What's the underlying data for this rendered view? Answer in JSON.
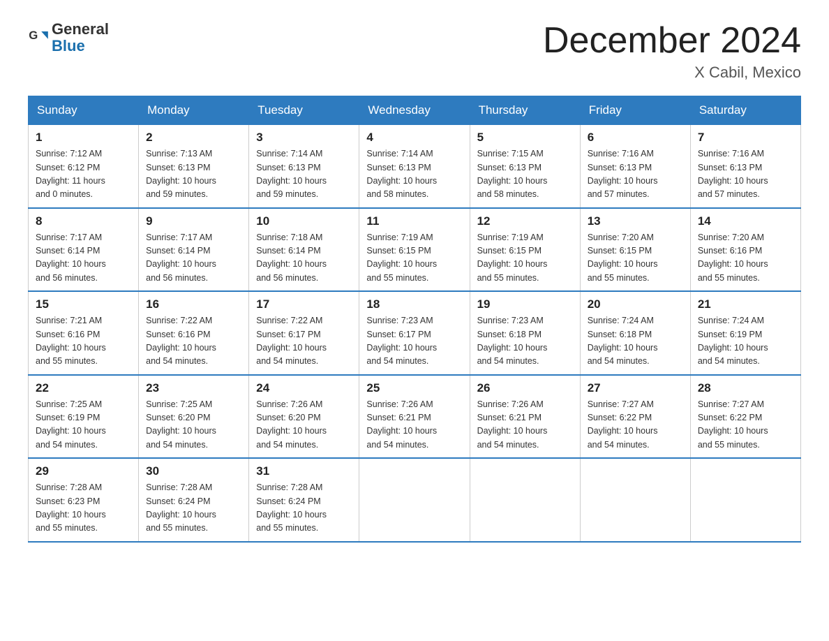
{
  "header": {
    "logo_line1": "General",
    "logo_line2": "Blue",
    "title": "December 2024",
    "subtitle": "X Cabil, Mexico"
  },
  "days_of_week": [
    "Sunday",
    "Monday",
    "Tuesday",
    "Wednesday",
    "Thursday",
    "Friday",
    "Saturday"
  ],
  "weeks": [
    [
      {
        "day": "1",
        "sunrise": "7:12 AM",
        "sunset": "6:12 PM",
        "daylight": "11 hours and 0 minutes."
      },
      {
        "day": "2",
        "sunrise": "7:13 AM",
        "sunset": "6:13 PM",
        "daylight": "10 hours and 59 minutes."
      },
      {
        "day": "3",
        "sunrise": "7:14 AM",
        "sunset": "6:13 PM",
        "daylight": "10 hours and 59 minutes."
      },
      {
        "day": "4",
        "sunrise": "7:14 AM",
        "sunset": "6:13 PM",
        "daylight": "10 hours and 58 minutes."
      },
      {
        "day": "5",
        "sunrise": "7:15 AM",
        "sunset": "6:13 PM",
        "daylight": "10 hours and 58 minutes."
      },
      {
        "day": "6",
        "sunrise": "7:16 AM",
        "sunset": "6:13 PM",
        "daylight": "10 hours and 57 minutes."
      },
      {
        "day": "7",
        "sunrise": "7:16 AM",
        "sunset": "6:13 PM",
        "daylight": "10 hours and 57 minutes."
      }
    ],
    [
      {
        "day": "8",
        "sunrise": "7:17 AM",
        "sunset": "6:14 PM",
        "daylight": "10 hours and 56 minutes."
      },
      {
        "day": "9",
        "sunrise": "7:17 AM",
        "sunset": "6:14 PM",
        "daylight": "10 hours and 56 minutes."
      },
      {
        "day": "10",
        "sunrise": "7:18 AM",
        "sunset": "6:14 PM",
        "daylight": "10 hours and 56 minutes."
      },
      {
        "day": "11",
        "sunrise": "7:19 AM",
        "sunset": "6:15 PM",
        "daylight": "10 hours and 55 minutes."
      },
      {
        "day": "12",
        "sunrise": "7:19 AM",
        "sunset": "6:15 PM",
        "daylight": "10 hours and 55 minutes."
      },
      {
        "day": "13",
        "sunrise": "7:20 AM",
        "sunset": "6:15 PM",
        "daylight": "10 hours and 55 minutes."
      },
      {
        "day": "14",
        "sunrise": "7:20 AM",
        "sunset": "6:16 PM",
        "daylight": "10 hours and 55 minutes."
      }
    ],
    [
      {
        "day": "15",
        "sunrise": "7:21 AM",
        "sunset": "6:16 PM",
        "daylight": "10 hours and 55 minutes."
      },
      {
        "day": "16",
        "sunrise": "7:22 AM",
        "sunset": "6:16 PM",
        "daylight": "10 hours and 54 minutes."
      },
      {
        "day": "17",
        "sunrise": "7:22 AM",
        "sunset": "6:17 PM",
        "daylight": "10 hours and 54 minutes."
      },
      {
        "day": "18",
        "sunrise": "7:23 AM",
        "sunset": "6:17 PM",
        "daylight": "10 hours and 54 minutes."
      },
      {
        "day": "19",
        "sunrise": "7:23 AM",
        "sunset": "6:18 PM",
        "daylight": "10 hours and 54 minutes."
      },
      {
        "day": "20",
        "sunrise": "7:24 AM",
        "sunset": "6:18 PM",
        "daylight": "10 hours and 54 minutes."
      },
      {
        "day": "21",
        "sunrise": "7:24 AM",
        "sunset": "6:19 PM",
        "daylight": "10 hours and 54 minutes."
      }
    ],
    [
      {
        "day": "22",
        "sunrise": "7:25 AM",
        "sunset": "6:19 PM",
        "daylight": "10 hours and 54 minutes."
      },
      {
        "day": "23",
        "sunrise": "7:25 AM",
        "sunset": "6:20 PM",
        "daylight": "10 hours and 54 minutes."
      },
      {
        "day": "24",
        "sunrise": "7:26 AM",
        "sunset": "6:20 PM",
        "daylight": "10 hours and 54 minutes."
      },
      {
        "day": "25",
        "sunrise": "7:26 AM",
        "sunset": "6:21 PM",
        "daylight": "10 hours and 54 minutes."
      },
      {
        "day": "26",
        "sunrise": "7:26 AM",
        "sunset": "6:21 PM",
        "daylight": "10 hours and 54 minutes."
      },
      {
        "day": "27",
        "sunrise": "7:27 AM",
        "sunset": "6:22 PM",
        "daylight": "10 hours and 54 minutes."
      },
      {
        "day": "28",
        "sunrise": "7:27 AM",
        "sunset": "6:22 PM",
        "daylight": "10 hours and 55 minutes."
      }
    ],
    [
      {
        "day": "29",
        "sunrise": "7:28 AM",
        "sunset": "6:23 PM",
        "daylight": "10 hours and 55 minutes."
      },
      {
        "day": "30",
        "sunrise": "7:28 AM",
        "sunset": "6:24 PM",
        "daylight": "10 hours and 55 minutes."
      },
      {
        "day": "31",
        "sunrise": "7:28 AM",
        "sunset": "6:24 PM",
        "daylight": "10 hours and 55 minutes."
      },
      null,
      null,
      null,
      null
    ]
  ]
}
